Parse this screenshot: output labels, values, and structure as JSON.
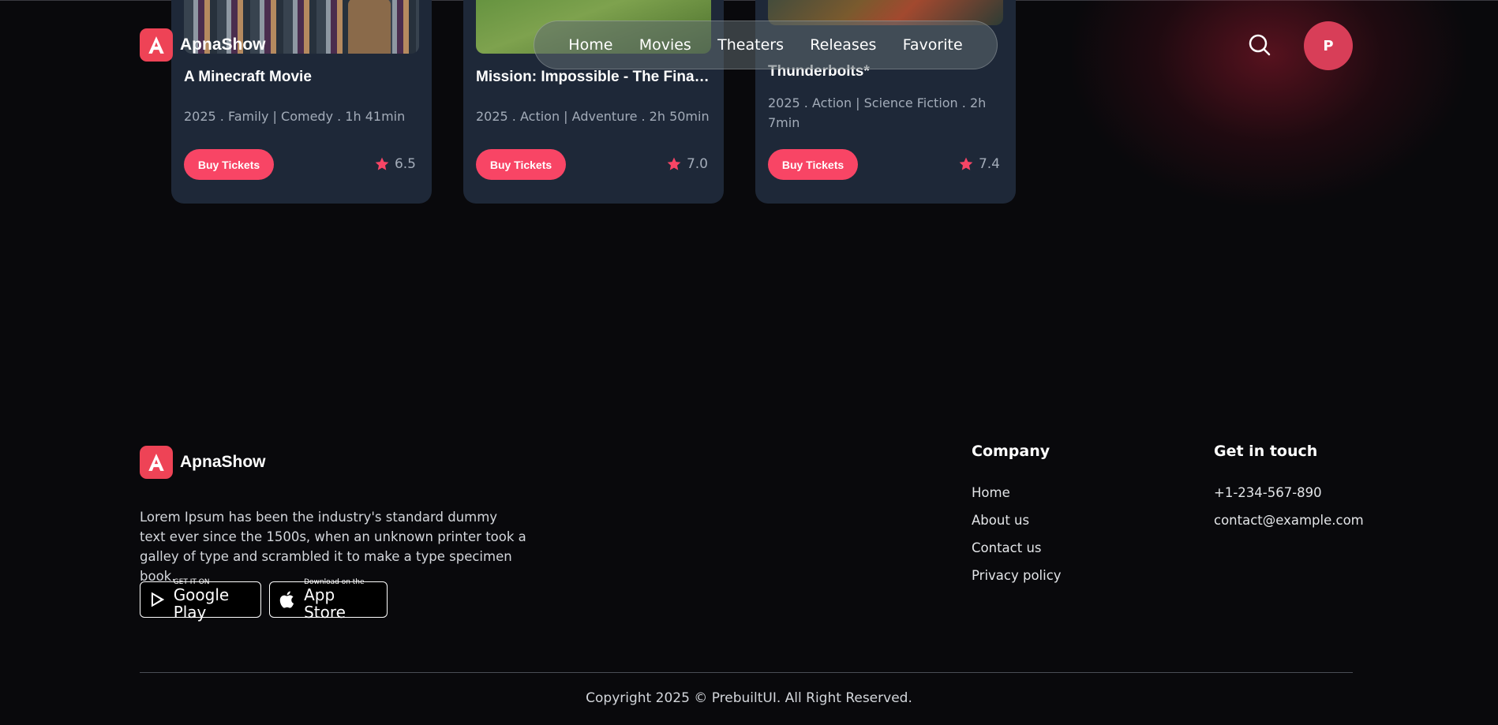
{
  "brand": {
    "name": "ApnaShow",
    "logo_letter": "A",
    "accent": "#f84565"
  },
  "nav": {
    "items": [
      "Home",
      "Movies",
      "Theaters",
      "Releases",
      "Favorite"
    ]
  },
  "header": {
    "search_icon": "search-icon",
    "avatar_initial": "P"
  },
  "movies": [
    {
      "title": "A Minecraft Movie",
      "meta": "2025 . Family | Comedy . 1h 41min",
      "button": "Buy Tickets",
      "rating": "6.5"
    },
    {
      "title": "Mission: Impossible - The Final Reckoning",
      "meta": "2025 . Action | Adventure . 2h 50min",
      "button": "Buy Tickets",
      "rating": "7.0"
    },
    {
      "title": "Thunderbolts*",
      "meta": "2025 . Action | Science Fiction . 2h 7min",
      "button": "Buy Tickets",
      "rating": "7.4"
    }
  ],
  "footer": {
    "description": "Lorem Ipsum has been the industry's standard dummy text ever since the 1500s, when an unknown printer took a galley of type and scrambled it to make a type specimen book.",
    "google_play": {
      "small": "GET IT ON",
      "big": "Google Play"
    },
    "app_store": {
      "small": "Download on the",
      "big": "App Store"
    },
    "company": {
      "title": "Company",
      "links": [
        "Home",
        "About us",
        "Contact us",
        "Privacy policy"
      ]
    },
    "contact": {
      "title": "Get in touch",
      "phone": "+1-234-567-890",
      "email": "contact@example.com"
    },
    "copyright": "Copyright 2025 © PrebuiltUI. All Right Reserved."
  }
}
